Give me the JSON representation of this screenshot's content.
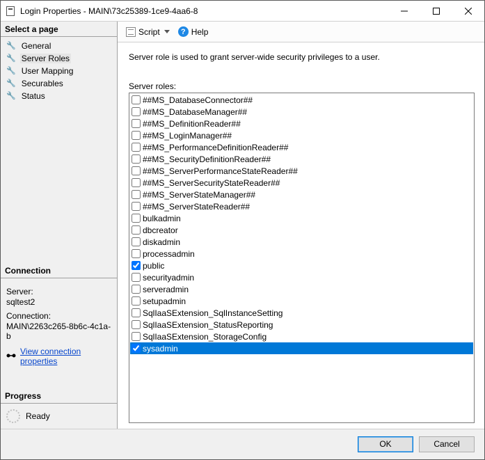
{
  "window": {
    "title": "Login Properties - MAIN\\73c25389-1ce9-4aa6-8"
  },
  "sidebar": {
    "heading_pages": "Select a page",
    "pages": [
      {
        "label": "General",
        "selected": false
      },
      {
        "label": "Server Roles",
        "selected": true
      },
      {
        "label": "User Mapping",
        "selected": false
      },
      {
        "label": "Securables",
        "selected": false
      },
      {
        "label": "Status",
        "selected": false
      }
    ],
    "heading_connection": "Connection",
    "server_label": "Server:",
    "server_value": "sqltest2",
    "connection_label": "Connection:",
    "connection_value": "MAIN\\2263c265-8b6c-4c1a-b",
    "view_props_link": "View connection properties",
    "heading_progress": "Progress",
    "progress_status": "Ready"
  },
  "toolbar": {
    "script_label": "Script",
    "help_label": "Help"
  },
  "main": {
    "description": "Server role is used to grant server-wide security privileges to a user.",
    "roles_label": "Server roles:",
    "roles": [
      {
        "name": "##MS_DatabaseConnector##",
        "checked": false,
        "selected": false
      },
      {
        "name": "##MS_DatabaseManager##",
        "checked": false,
        "selected": false
      },
      {
        "name": "##MS_DefinitionReader##",
        "checked": false,
        "selected": false
      },
      {
        "name": "##MS_LoginManager##",
        "checked": false,
        "selected": false
      },
      {
        "name": "##MS_PerformanceDefinitionReader##",
        "checked": false,
        "selected": false
      },
      {
        "name": "##MS_SecurityDefinitionReader##",
        "checked": false,
        "selected": false
      },
      {
        "name": "##MS_ServerPerformanceStateReader##",
        "checked": false,
        "selected": false
      },
      {
        "name": "##MS_ServerSecurityStateReader##",
        "checked": false,
        "selected": false
      },
      {
        "name": "##MS_ServerStateManager##",
        "checked": false,
        "selected": false
      },
      {
        "name": "##MS_ServerStateReader##",
        "checked": false,
        "selected": false
      },
      {
        "name": "bulkadmin",
        "checked": false,
        "selected": false
      },
      {
        "name": "dbcreator",
        "checked": false,
        "selected": false
      },
      {
        "name": "diskadmin",
        "checked": false,
        "selected": false
      },
      {
        "name": "processadmin",
        "checked": false,
        "selected": false
      },
      {
        "name": "public",
        "checked": true,
        "selected": false
      },
      {
        "name": "securityadmin",
        "checked": false,
        "selected": false
      },
      {
        "name": "serveradmin",
        "checked": false,
        "selected": false
      },
      {
        "name": "setupadmin",
        "checked": false,
        "selected": false
      },
      {
        "name": "SqlIaaSExtension_SqlInstanceSetting",
        "checked": false,
        "selected": false
      },
      {
        "name": "SqlIaaSExtension_StatusReporting",
        "checked": false,
        "selected": false
      },
      {
        "name": "SqlIaaSExtension_StorageConfig",
        "checked": false,
        "selected": false
      },
      {
        "name": "sysadmin",
        "checked": true,
        "selected": true
      }
    ]
  },
  "footer": {
    "ok_label": "OK",
    "cancel_label": "Cancel"
  }
}
